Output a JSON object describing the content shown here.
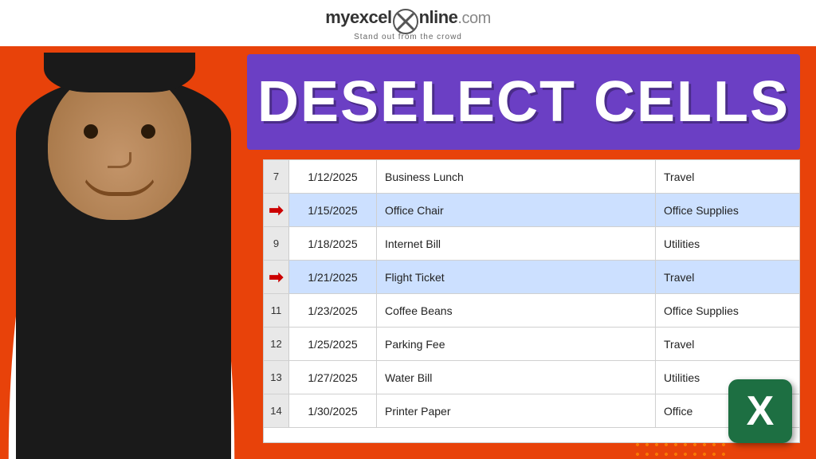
{
  "logo": {
    "prefix": "my",
    "brand": "excel",
    "suffix": "nline",
    "domain": ".com",
    "tagline": "Stand out from the crowd"
  },
  "title": "DESELECT CELLS",
  "spreadsheet": {
    "rows": [
      {
        "num": "7",
        "date": "1/12/2025",
        "description": "Business Lunch",
        "category": "Travel",
        "selected": false,
        "arrow": false
      },
      {
        "num": "",
        "date": "1/15/2025",
        "description": "Office Chair",
        "category": "Office Supplies",
        "selected": true,
        "arrow": true
      },
      {
        "num": "9",
        "date": "1/18/2025",
        "description": "Internet Bill",
        "category": "Utilities",
        "selected": false,
        "arrow": false
      },
      {
        "num": "",
        "date": "1/21/2025",
        "description": "Flight Ticket",
        "category": "Travel",
        "selected": true,
        "arrow": true
      },
      {
        "num": "11",
        "date": "1/23/2025",
        "description": "Coffee Beans",
        "category": "Office Supplies",
        "selected": false,
        "arrow": false
      },
      {
        "num": "12",
        "date": "1/25/2025",
        "description": "Parking Fee",
        "category": "Travel",
        "selected": false,
        "arrow": false
      },
      {
        "num": "13",
        "date": "1/27/2025",
        "description": "Water Bill",
        "category": "Utilities",
        "selected": false,
        "arrow": false
      },
      {
        "num": "14",
        "date": "1/30/2025",
        "description": "Printer Paper",
        "category": "Office",
        "selected": false,
        "arrow": false
      }
    ]
  },
  "excel_logo": "X",
  "colors": {
    "orange": "#e8420a",
    "purple": "#6b3fc4",
    "excel_green": "#1d6f42",
    "selected_blue": "#cce0ff"
  }
}
